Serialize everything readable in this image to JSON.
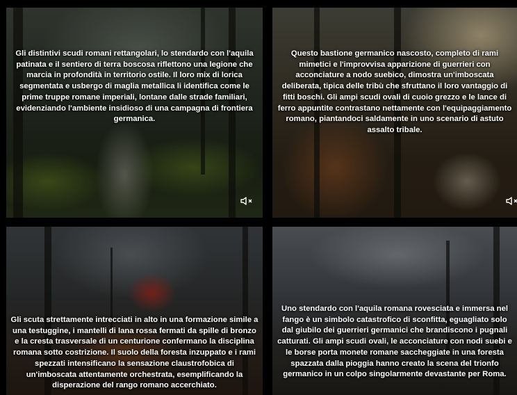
{
  "tiles": [
    {
      "caption": "Gli distintivi scudi romani rettangolari, lo stendardo con l'aquila patinata e il sentiero di terra boscosa riflettono una legione che marcia in profondità in territorio ostile. Il loro mix di lorica segmentata e usbergo di maglia metallica li identifica come le prime truppe romane imperiali, lontane dalle strade familiari, evidenziando l'ambiente insidioso di una campagna di frontiera germanica.",
      "mute_icon": "speaker-muted-icon"
    },
    {
      "caption": "Questo bastione germanico nascosto, completo di rami mimetici e l'improvvisa apparizione di guerrieri con acconciature a nodo suebico, dimostra un'imboscata deliberata, tipica delle tribù che sfruttano il loro vantaggio di fitti boschi. Gli ampi scudi ovali di cuoio grezzo e le lance di ferro appuntite contrastano nettamente con l'equipaggiamento romano, piantandoci saldamente in uno scenario di astuto assalto tribale.",
      "mute_icon": "speaker-muted-icon"
    },
    {
      "caption": "Gli scuta strettamente intrecciati in alto in una formazione simile a una testuggine, i mantelli di lana rossa fermati da spille di bronzo e la cresta trasversale di un centurione confermano la disciplina romana sotto costrizione. Il suolo della foresta inzuppato e i rami spezzati intensificano la sensazione claustrofobica di un'imboscata attentamente orchestrata, esemplificando la disperazione del rango romano accerchiato."
    },
    {
      "caption": "Uno stendardo con l'aquila romana rovesciata e immersa nel fango è un simbolo catastrofico di sconfitta, eguagliato solo dal giubilo dei guerrieri germanici che brandiscono i pugnali catturati. Gli ampi scudi ovali, le acconciature con nodi suebi e le borse porta monete romane saccheggiate in una foresta spazzata dalla pioggia hanno creato la scena del trionfo germanico in un colpo singolarmente devastante per Roma."
    }
  ]
}
